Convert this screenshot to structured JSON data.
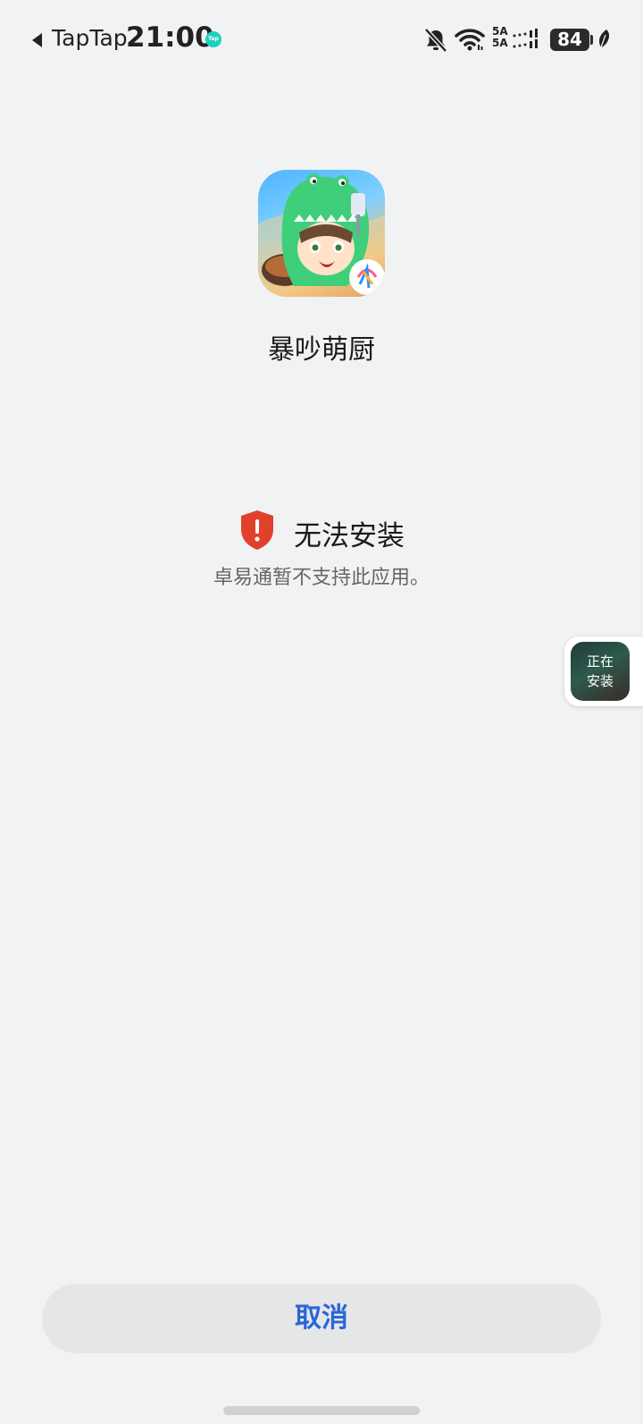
{
  "status_bar": {
    "back_app": "TapTap",
    "time": "21:00",
    "notification_app_icon": "tap-badge-icon",
    "network_top": "5A",
    "network_bottom": "5A",
    "battery_level": "84",
    "icons": [
      "bell-muted-icon",
      "wifi-icon",
      "signal-icon",
      "battery-icon",
      "leaf-icon"
    ]
  },
  "app": {
    "name": "暴吵萌厨",
    "icon": "game-app-icon"
  },
  "message": {
    "icon": "warning-shield-icon",
    "title": "无法安装",
    "description": "卓易通暂不支持此应用。",
    "accent_color": "#e0412b"
  },
  "floating_widget": {
    "line1": "正在",
    "line2": "安装"
  },
  "actions": {
    "cancel_label": "取消",
    "cancel_color": "#2a66d6"
  }
}
